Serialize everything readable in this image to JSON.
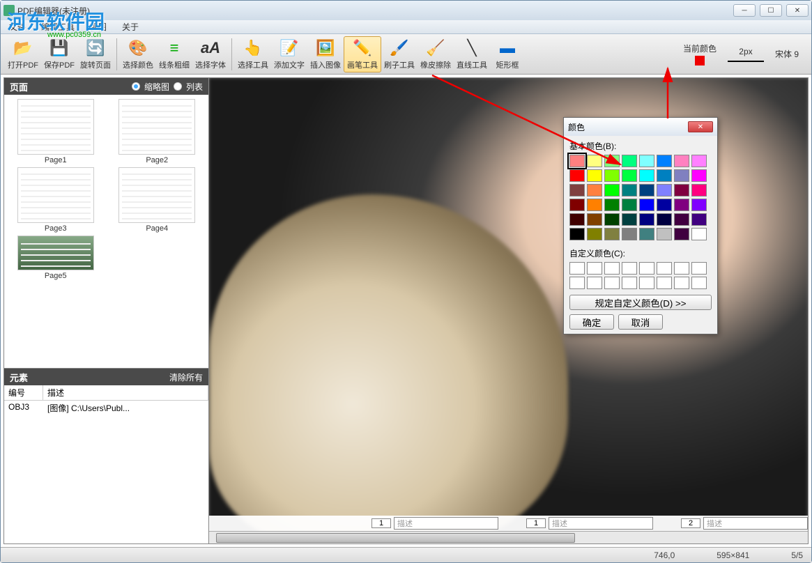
{
  "window": {
    "title": "PDF编辑器(未注册)"
  },
  "watermark": {
    "text": "河东软件园",
    "url": "www.pc0359.cn"
  },
  "menu": {
    "file": "文件",
    "editTools": "编辑工具",
    "view": "视图",
    "about": "关于"
  },
  "toolbar": {
    "openPdf": "打开PDF",
    "savePdf": "保存PDF",
    "rotatePage": "旋转页面",
    "selectColor": "选择颜色",
    "lineWidth": "线条粗细",
    "selectFont": "选择字体",
    "selectTool": "选择工具",
    "addText": "添加文字",
    "insertImage": "插入图像",
    "brushTool": "画笔工具",
    "brushTool2": "刷子工具",
    "eraser": "橡皮擦除",
    "lineTool": "直线工具",
    "rectTool": "矩形框"
  },
  "toolbarRight": {
    "currentColorLabel": "当前颜色",
    "currentColor": "#ee0000",
    "strokeLabel": "2px",
    "fontLabel": "宋体 9"
  },
  "pagesPanel": {
    "title": "页面",
    "viewThumb": "缩略图",
    "viewList": "列表",
    "pages": [
      "Page1",
      "Page2",
      "Page3",
      "Page4",
      "Page5"
    ]
  },
  "elementsPanel": {
    "title": "元素",
    "clearAll": "清除所有",
    "colId": "编号",
    "colDesc": "描述",
    "rows": [
      {
        "id": "OBJ3",
        "desc": "[图像] C:\\Users\\Publ..."
      }
    ]
  },
  "bottomRuler": {
    "segments": [
      {
        "num": "1",
        "desc": "描述"
      },
      {
        "num": "1",
        "desc": "描述"
      },
      {
        "num": "2",
        "desc": "描述"
      }
    ]
  },
  "status": {
    "pos": "746,0",
    "dim": "595×841",
    "page": "5/5"
  },
  "colorDialog": {
    "title": "颜色",
    "basicLabel": "基本颜色(B):",
    "customLabel": "自定义颜色(C):",
    "defineCustom": "规定自定义颜色(D) >>",
    "ok": "确定",
    "cancel": "取消",
    "selectedIndex": 0,
    "basicColors": [
      "#ff8080",
      "#ffff80",
      "#80ff80",
      "#00ff80",
      "#80ffff",
      "#0080ff",
      "#ff80c0",
      "#ff80ff",
      "#ff0000",
      "#ffff00",
      "#80ff00",
      "#00ff40",
      "#00ffff",
      "#0080c0",
      "#8080c0",
      "#ff00ff",
      "#804040",
      "#ff8040",
      "#00ff00",
      "#008080",
      "#004080",
      "#8080ff",
      "#800040",
      "#ff0080",
      "#800000",
      "#ff8000",
      "#008000",
      "#008040",
      "#0000ff",
      "#0000a0",
      "#800080",
      "#8000ff",
      "#400000",
      "#804000",
      "#004000",
      "#004040",
      "#000080",
      "#000040",
      "#400040",
      "#400080",
      "#000000",
      "#808000",
      "#808040",
      "#808080",
      "#408080",
      "#c0c0c0",
      "#400040",
      "#ffffff"
    ]
  }
}
